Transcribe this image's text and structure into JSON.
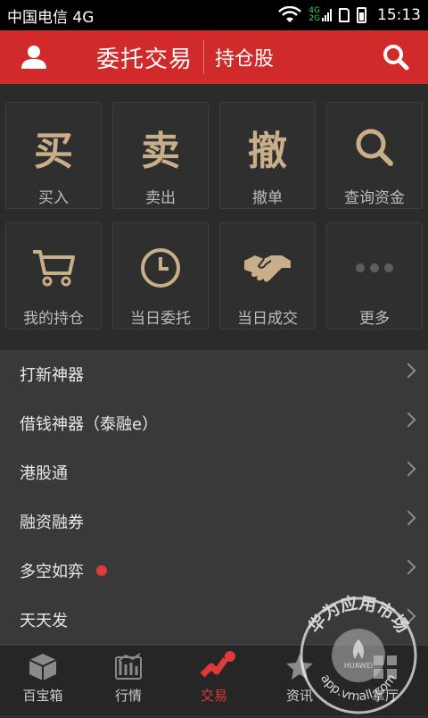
{
  "status_bar": {
    "carrier": "中国电信 4G",
    "network_top": "4G",
    "network_bottom": "2G",
    "time": "15:13"
  },
  "header": {
    "title": "委托交易",
    "subtitle": "持仓股"
  },
  "grid": [
    {
      "glyph": "买",
      "label": "买入"
    },
    {
      "glyph": "卖",
      "label": "卖出"
    },
    {
      "glyph": "撤",
      "label": "撤单"
    },
    {
      "icon": "search-icon",
      "label": "查询资金"
    },
    {
      "icon": "cart-icon",
      "label": "我的持仓"
    },
    {
      "icon": "clock-icon",
      "label": "当日委托"
    },
    {
      "icon": "handshake-icon",
      "label": "当日成交"
    },
    {
      "icon": "more-dots-icon",
      "label": "更多"
    }
  ],
  "list": [
    {
      "label": "打新神器"
    },
    {
      "label": "借钱神器（泰融e）"
    },
    {
      "label": "港股通"
    },
    {
      "label": "融资融券"
    },
    {
      "label": "多空如弈",
      "badge": true
    },
    {
      "label": "天天发"
    }
  ],
  "bottom_nav": [
    {
      "label": "百宝箱",
      "icon": "box-icon"
    },
    {
      "label": "行情",
      "icon": "market-icon"
    },
    {
      "label": "交易",
      "icon": "trade-icon",
      "active": true,
      "badge": true
    },
    {
      "label": "资讯",
      "icon": "star-icon"
    },
    {
      "label": "掌厅",
      "icon": "hall-icon"
    }
  ],
  "watermark": {
    "text_top": "华为应用市场",
    "text_bottom": "app.vmall.com",
    "logo_text": "HUAWEI"
  },
  "colors": {
    "header_red": "#d02a2a",
    "accent_gold": "#c9ae8a",
    "active_red": "#e0393c"
  }
}
